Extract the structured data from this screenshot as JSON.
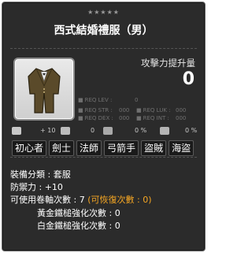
{
  "item": {
    "stars": "★★★★★",
    "name": "西式結婚禮服（男）",
    "attack_increase_label": "攻擊力提升量",
    "attack_increase_value": "0"
  },
  "requirements": [
    {
      "label": "REQ LEV :",
      "value": "0"
    },
    {
      "label": "REQ STR :",
      "value": "000"
    },
    {
      "label": "REQ LUK :",
      "value": "000"
    },
    {
      "label": "REQ DEX :",
      "value": "000"
    },
    {
      "label": "REQ INT :",
      "value": "000"
    }
  ],
  "stats": {
    "plus_value": "+ 10",
    "zero_a": "0",
    "zero_b": "0 %",
    "zero_c": "0 %"
  },
  "jobs": [
    "初心者",
    "劍士",
    "法師",
    "弓箭手",
    "盜賊",
    "海盜"
  ],
  "info": {
    "category_label": "裝備分類 :",
    "category_value": "套服",
    "defense_label": "防禦力 :",
    "defense_value": "+10",
    "scroll_label": "可使用卷軸次數 :",
    "scroll_value": "7",
    "restore_text": "(可恢復次數 : 0)",
    "gold_hammer_label": "黃金鐵槌強化次數 :",
    "gold_hammer_value": "0",
    "platinum_hammer_label": "白金鐵槌強化次數 :",
    "platinum_hammer_value": "0"
  },
  "colors": {
    "panel_bg": "#2b2b2b",
    "accent_orange": "#f5a623",
    "text_main": "#ffffff",
    "text_dim": "#707070"
  }
}
